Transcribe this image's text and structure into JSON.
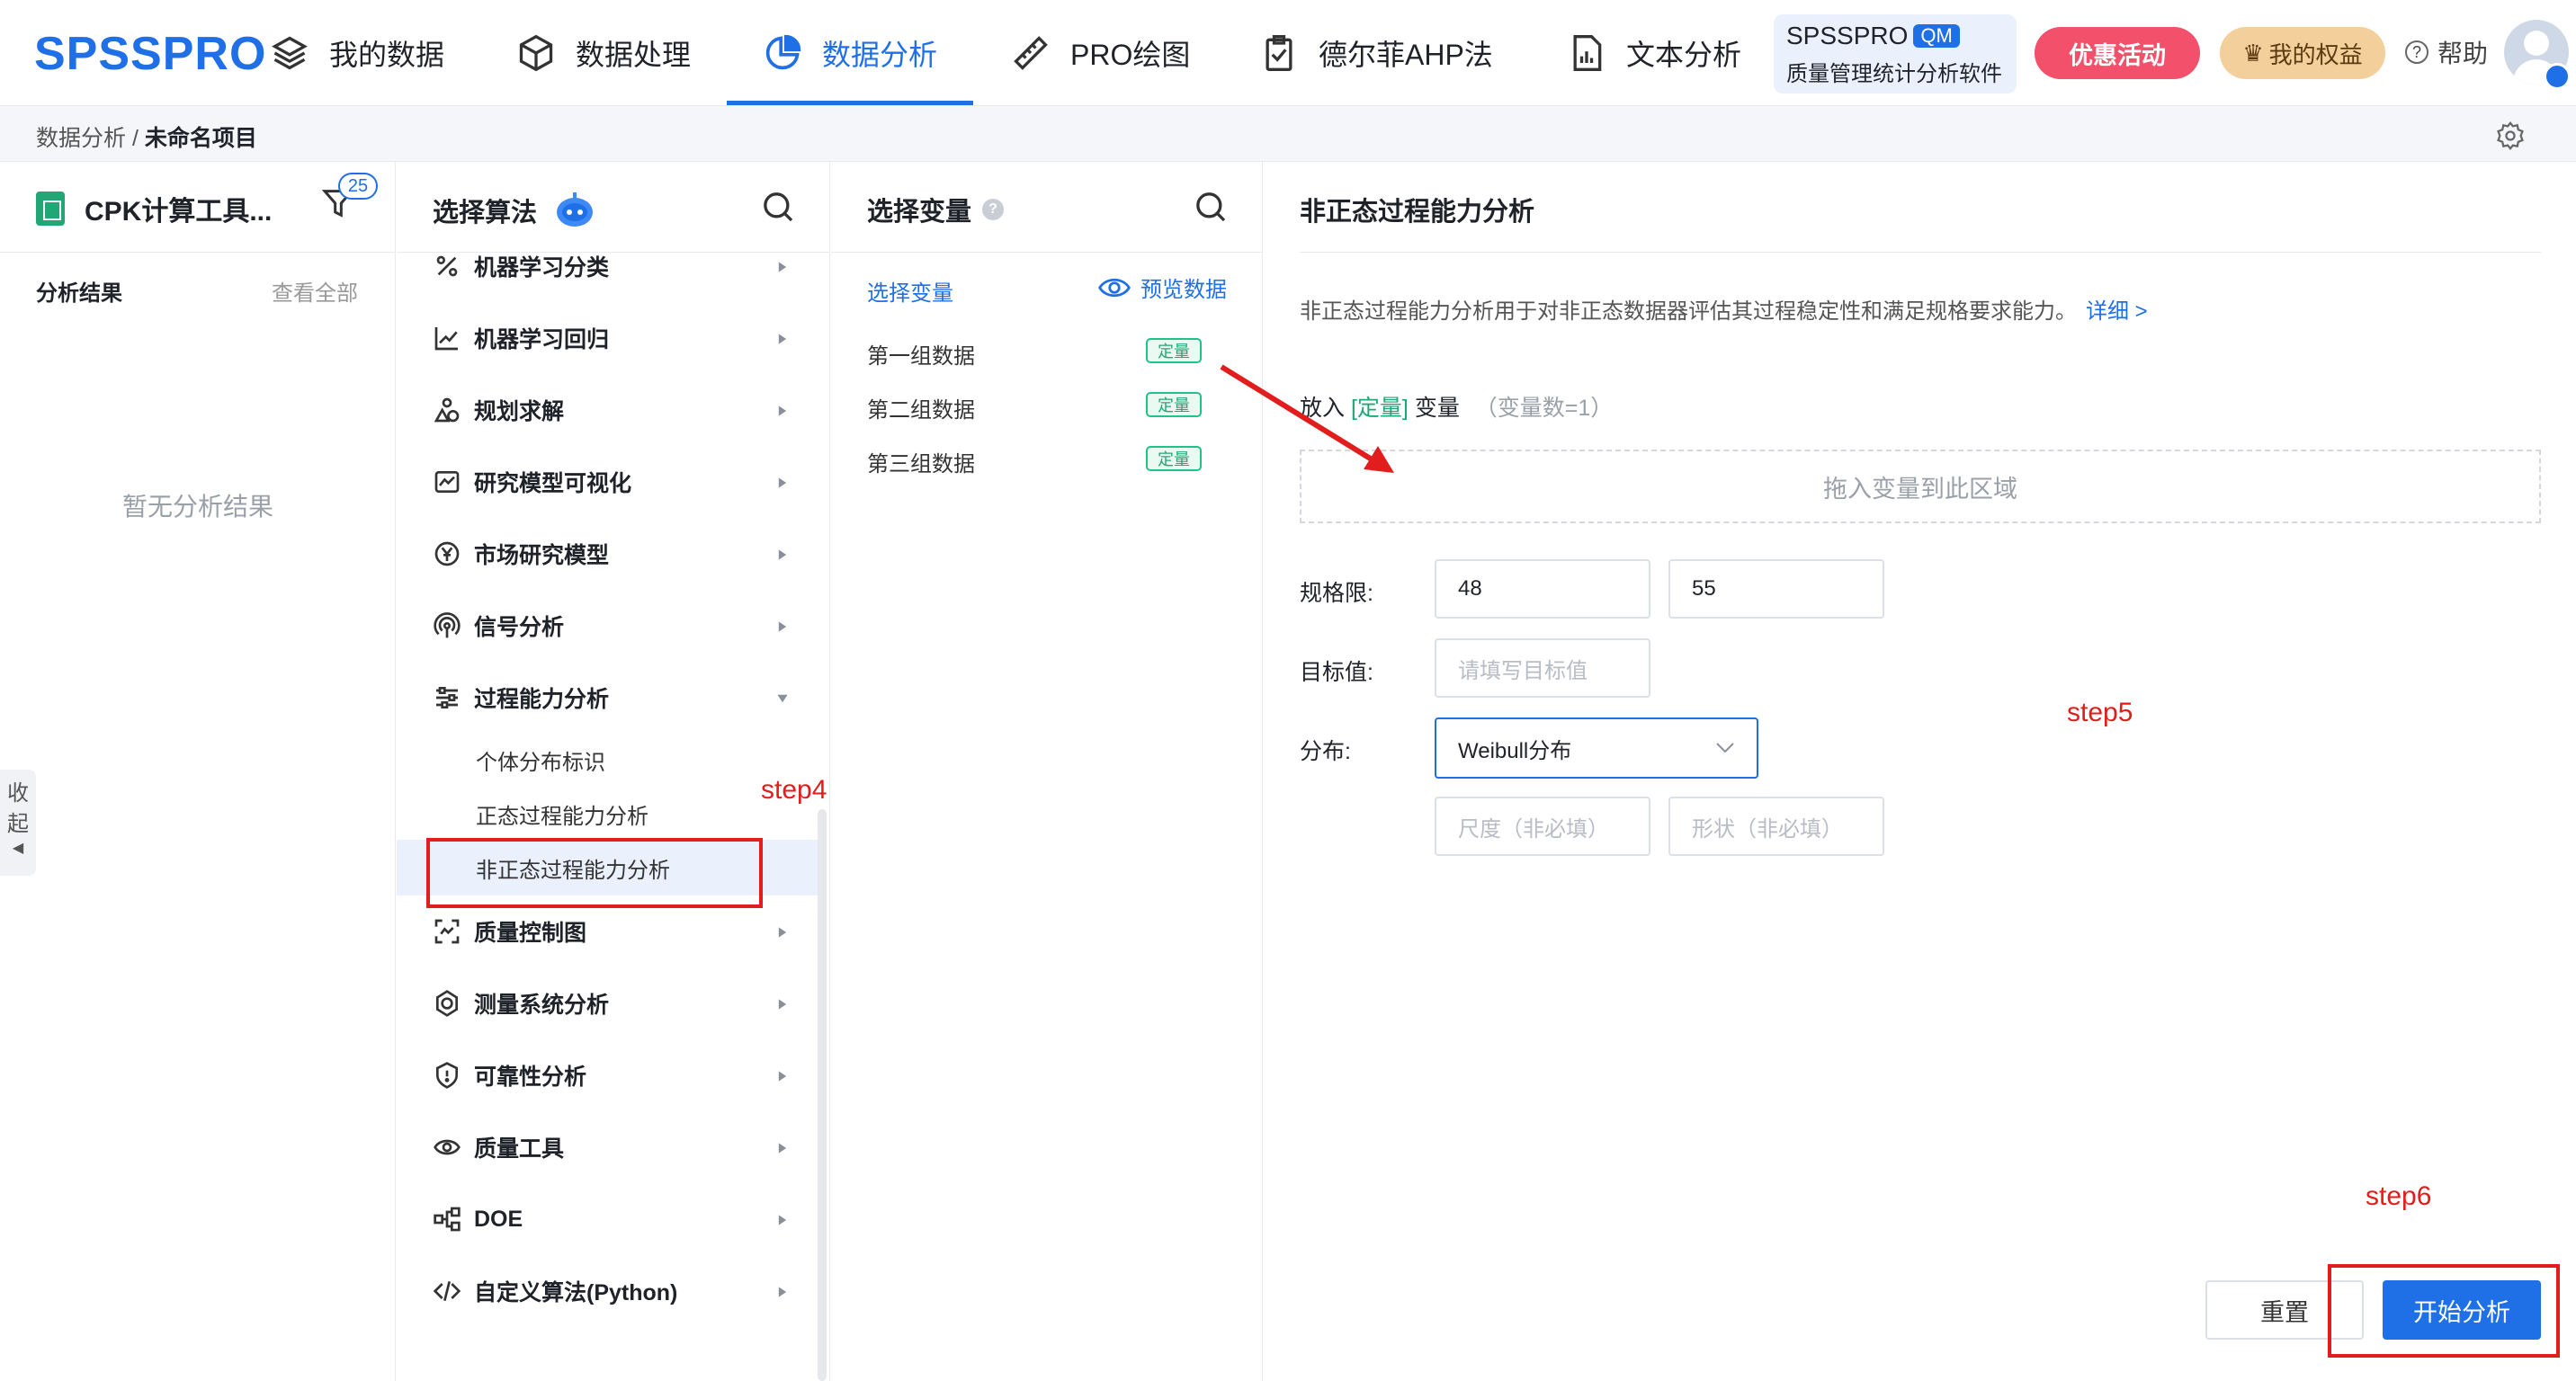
{
  "header": {
    "logo": "SPSSPRO",
    "nav": [
      {
        "label": "我的数据",
        "icon": "layers-icon"
      },
      {
        "label": "数据处理",
        "icon": "cube-icon"
      },
      {
        "label": "数据分析",
        "icon": "pie-chart-icon"
      },
      {
        "label": "PRO绘图",
        "icon": "ruler-pencil-icon"
      },
      {
        "label": "德尔菲AHP法",
        "icon": "clipboard-check-icon"
      },
      {
        "label": "文本分析",
        "icon": "document-chart-icon"
      }
    ],
    "active_nav": "数据分析",
    "qm_title": "SPSSPRO",
    "qm_badge": "QM",
    "qm_subtitle": "质量管理统计分析软件",
    "promo_label": "优惠活动",
    "rights_label": "我的权益",
    "help_label": "帮助"
  },
  "breadcrumb": {
    "root": "数据分析",
    "separator": " / ",
    "current": "未命名项目"
  },
  "left_panel": {
    "project_title": "CPK计算工具...",
    "filter_count": "25",
    "results_title": "分析结果",
    "view_all": "查看全部",
    "empty_text": "暂无分析结果",
    "collapse_label": "收起"
  },
  "algorithms": {
    "title": "选择算法",
    "items": [
      {
        "label": "机器学习分类",
        "icon": "percent-icon"
      },
      {
        "label": "机器学习回归",
        "icon": "trend-chart-icon"
      },
      {
        "label": "规划求解",
        "icon": "shapes-icon"
      },
      {
        "label": "研究模型可视化",
        "icon": "line-chart-icon"
      },
      {
        "label": "市场研究模型",
        "icon": "yen-icon"
      },
      {
        "label": "信号分析",
        "icon": "signal-icon"
      },
      {
        "label": "过程能力分析",
        "icon": "sliders-icon"
      },
      {
        "label": "质量控制图",
        "icon": "scan-icon"
      },
      {
        "label": "测量系统分析",
        "icon": "gauge-icon"
      },
      {
        "label": "可靠性分析",
        "icon": "shield-icon"
      },
      {
        "label": "质量工具",
        "icon": "eye-tool-icon"
      },
      {
        "label": "DOE",
        "icon": "flow-icon"
      },
      {
        "label": "自定义算法(Python)",
        "icon": "code-icon"
      }
    ],
    "sub_items": [
      "个体分布标识",
      "正态过程能力分析",
      "非正态过程能力分析"
    ],
    "active_sub": "非正态过程能力分析"
  },
  "variables": {
    "title": "选择变量",
    "select_label": "选择变量",
    "preview_label": "预览数据",
    "rows": [
      {
        "name": "第一组数据",
        "tag": "定量"
      },
      {
        "name": "第二组数据",
        "tag": "定量"
      },
      {
        "name": "第三组数据",
        "tag": "定量"
      }
    ]
  },
  "config": {
    "title": "非正态过程能力分析",
    "description": "非正态过程能力分析用于对非正态数据器评估其过程稳定性和满足规格要求能力。",
    "detail_link": "详细 >",
    "put_prefix": "放入",
    "put_tag": "[定量]",
    "put_suffix": "变量",
    "put_count": "（变量数=1）",
    "drop_hint": "拖入变量到此区域",
    "spec_label": "规格限:",
    "spec_lower": "48",
    "spec_upper": "55",
    "target_label": "目标值:",
    "target_placeholder": "请填写目标值",
    "dist_label": "分布:",
    "dist_value": "Weibull分布",
    "scale_placeholder": "尺度（非必填）",
    "shape_placeholder": "形状（非必填）",
    "reset_label": "重置",
    "start_label": "开始分析"
  },
  "annotations": {
    "step4": "step4",
    "step5": "step5",
    "step6": "step6",
    "color": "#e11d1d"
  },
  "colors": {
    "brand": "#1f6fe6",
    "promo": "#f2506b",
    "rights": "#f3cf9b",
    "tag_green": "#21a675"
  }
}
